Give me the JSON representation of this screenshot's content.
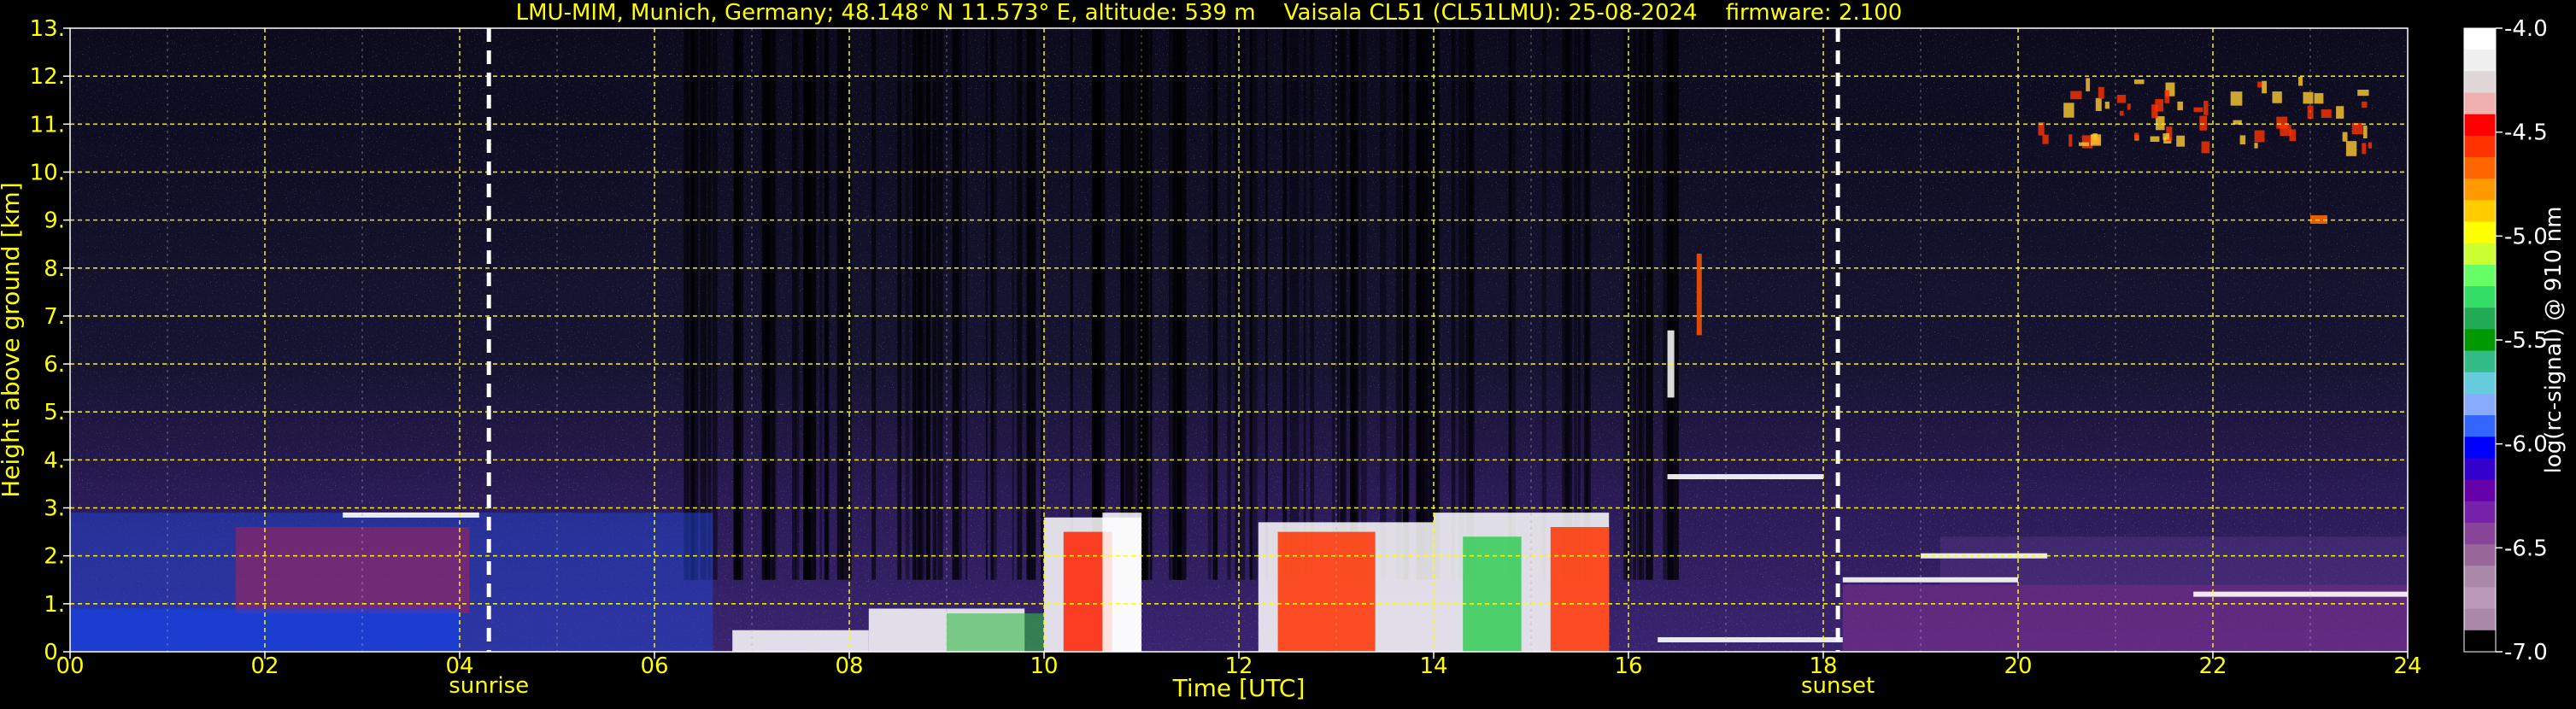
{
  "chart_data": {
    "type": "heatmap",
    "title": "LMU-MIM, Munich, Germany; 48.148° N 11.573° E, altitude: 539 m    Vaisala CL51 (CL51LMU): 25-08-2024    firmware: 2.100",
    "xlabel": "Time [UTC]",
    "ylabel": "Height above ground [km]",
    "xlim": [
      0,
      24
    ],
    "ylim": [
      0,
      13
    ],
    "x_ticks": [
      "00",
      "02",
      "04",
      "06",
      "08",
      "10",
      "12",
      "14",
      "16",
      "18",
      "20",
      "22",
      "24"
    ],
    "x_tick_values": [
      0,
      2,
      4,
      6,
      8,
      10,
      12,
      14,
      16,
      18,
      20,
      22,
      24
    ],
    "y_ticks": [
      "0.",
      "1.",
      "2.",
      "3.",
      "4.",
      "5.",
      "6.",
      "7.",
      "8.",
      "9.",
      "10.",
      "11.",
      "12.",
      "13."
    ],
    "y_tick_values": [
      0,
      1,
      2,
      3,
      4,
      5,
      6,
      7,
      8,
      9,
      10,
      11,
      12,
      13
    ],
    "grid": true,
    "markers": [
      {
        "label": "sunrise",
        "x": 4.3
      },
      {
        "label": "sunset",
        "x": 18.15
      }
    ],
    "colorbar": {
      "label": "log(rc-signal) @ 910 nm",
      "range": [
        -7.0,
        -4.0
      ],
      "ticks": [
        "-4.0",
        "-4.5",
        "-5.0",
        "-5.5",
        "-6.0",
        "-6.5",
        "-7.0"
      ],
      "tick_values": [
        -4.0,
        -4.5,
        -5.0,
        -5.5,
        -6.0,
        -6.5,
        -7.0
      ],
      "colors": [
        "#ffffff",
        "#f0f0f0",
        "#e0d8d8",
        "#f0b0b0",
        "#ff0000",
        "#ff3300",
        "#ff6600",
        "#ff9900",
        "#ffcc00",
        "#ffff00",
        "#ccff33",
        "#66ff66",
        "#33dd66",
        "#22aa55",
        "#009900",
        "#33bb88",
        "#66ccdd",
        "#88aaff",
        "#3366ff",
        "#0000ff",
        "#3300cc",
        "#6600aa",
        "#7722aa",
        "#884499",
        "#996699",
        "#aa88aa",
        "#bb99bb",
        "#aa88aa",
        "#000000"
      ]
    },
    "colors": {
      "text": "#ffff00",
      "grid": "#ffff00",
      "marker": "#ffffff",
      "background": "#000000"
    }
  }
}
